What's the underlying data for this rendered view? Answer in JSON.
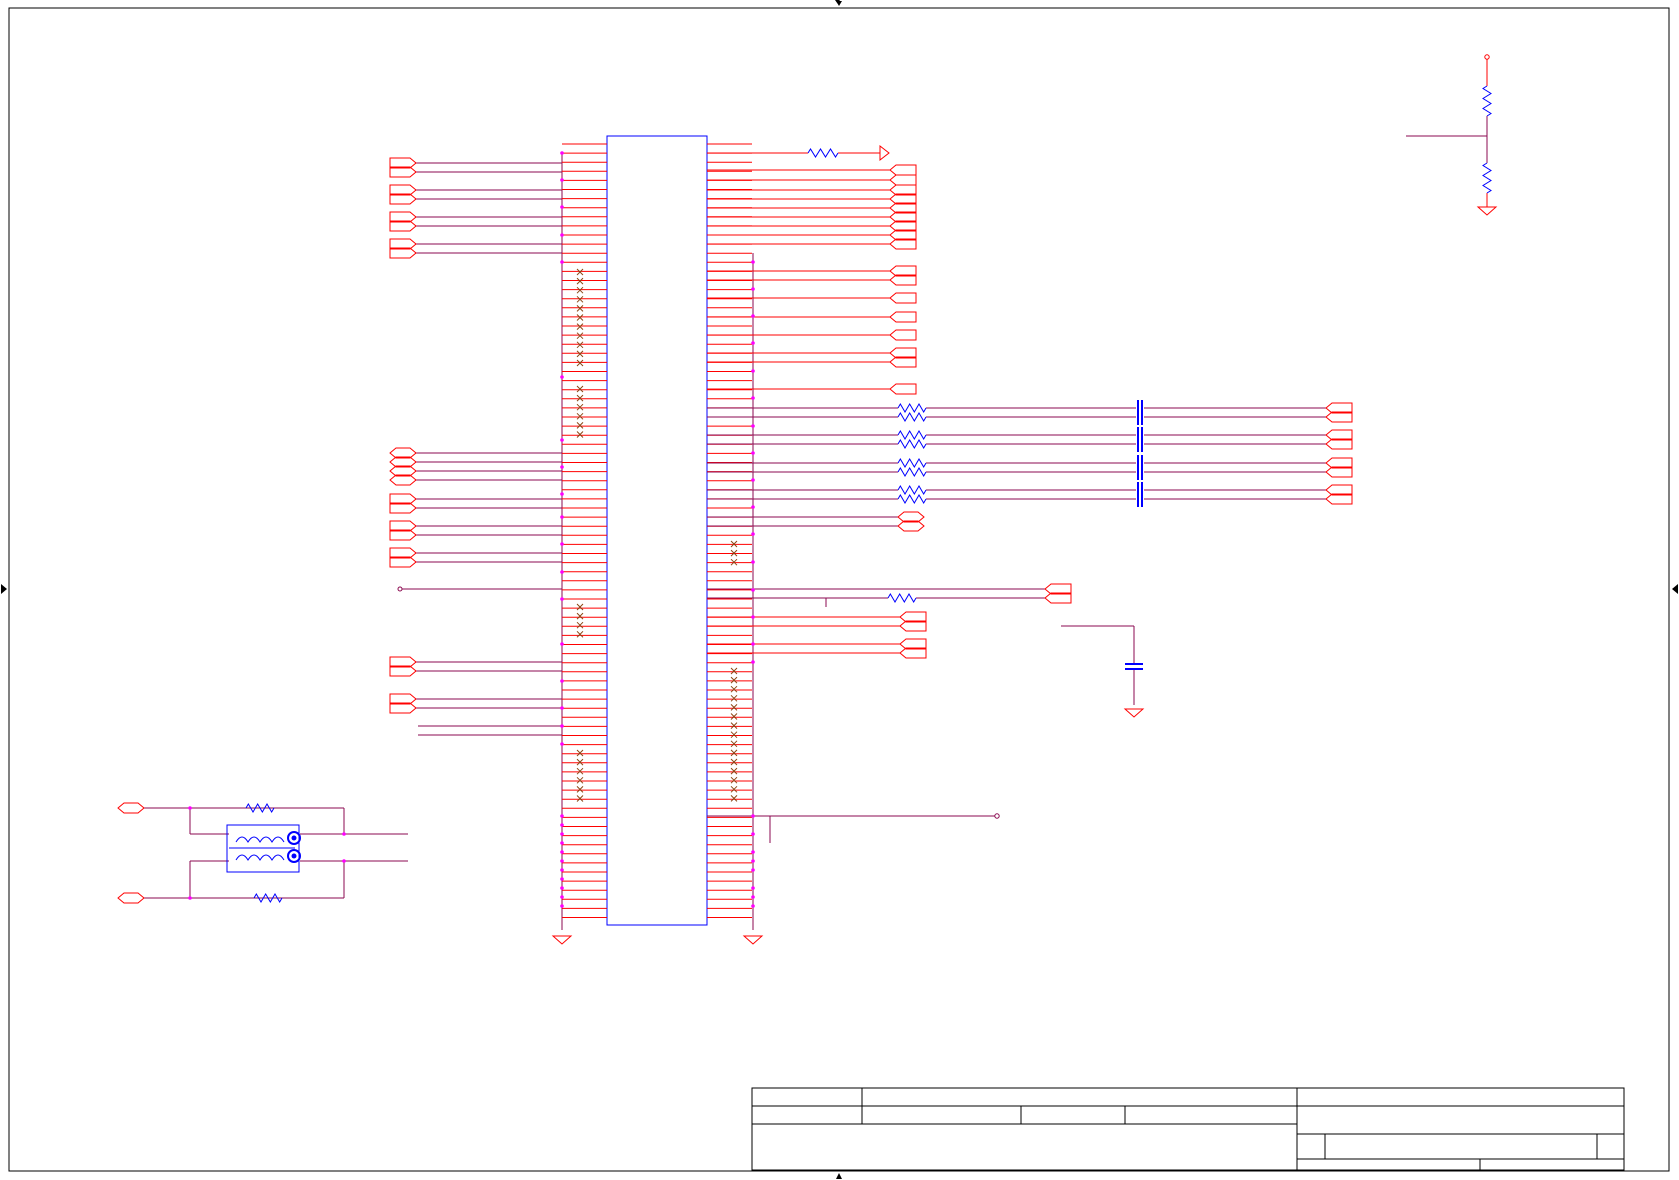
{
  "colors": {
    "wire": "#8b0a50",
    "pin": "#ff0000",
    "component": "#0000ff",
    "junction": "#ff00ff",
    "no_connect": "#8b4513",
    "frame": "#000000"
  },
  "icons": {
    "resistor": "resistor-icon",
    "capacitor": "capacitor-icon",
    "ground": "ground-icon",
    "port": "port-flag-icon",
    "no_connect": "no-connect-x-icon",
    "transformer": "transformer-icon"
  },
  "title_block": {
    "title": "",
    "company": "",
    "drawn_by": "",
    "date": "",
    "size": "",
    "document_number": "",
    "revision": "",
    "sheet": ""
  }
}
